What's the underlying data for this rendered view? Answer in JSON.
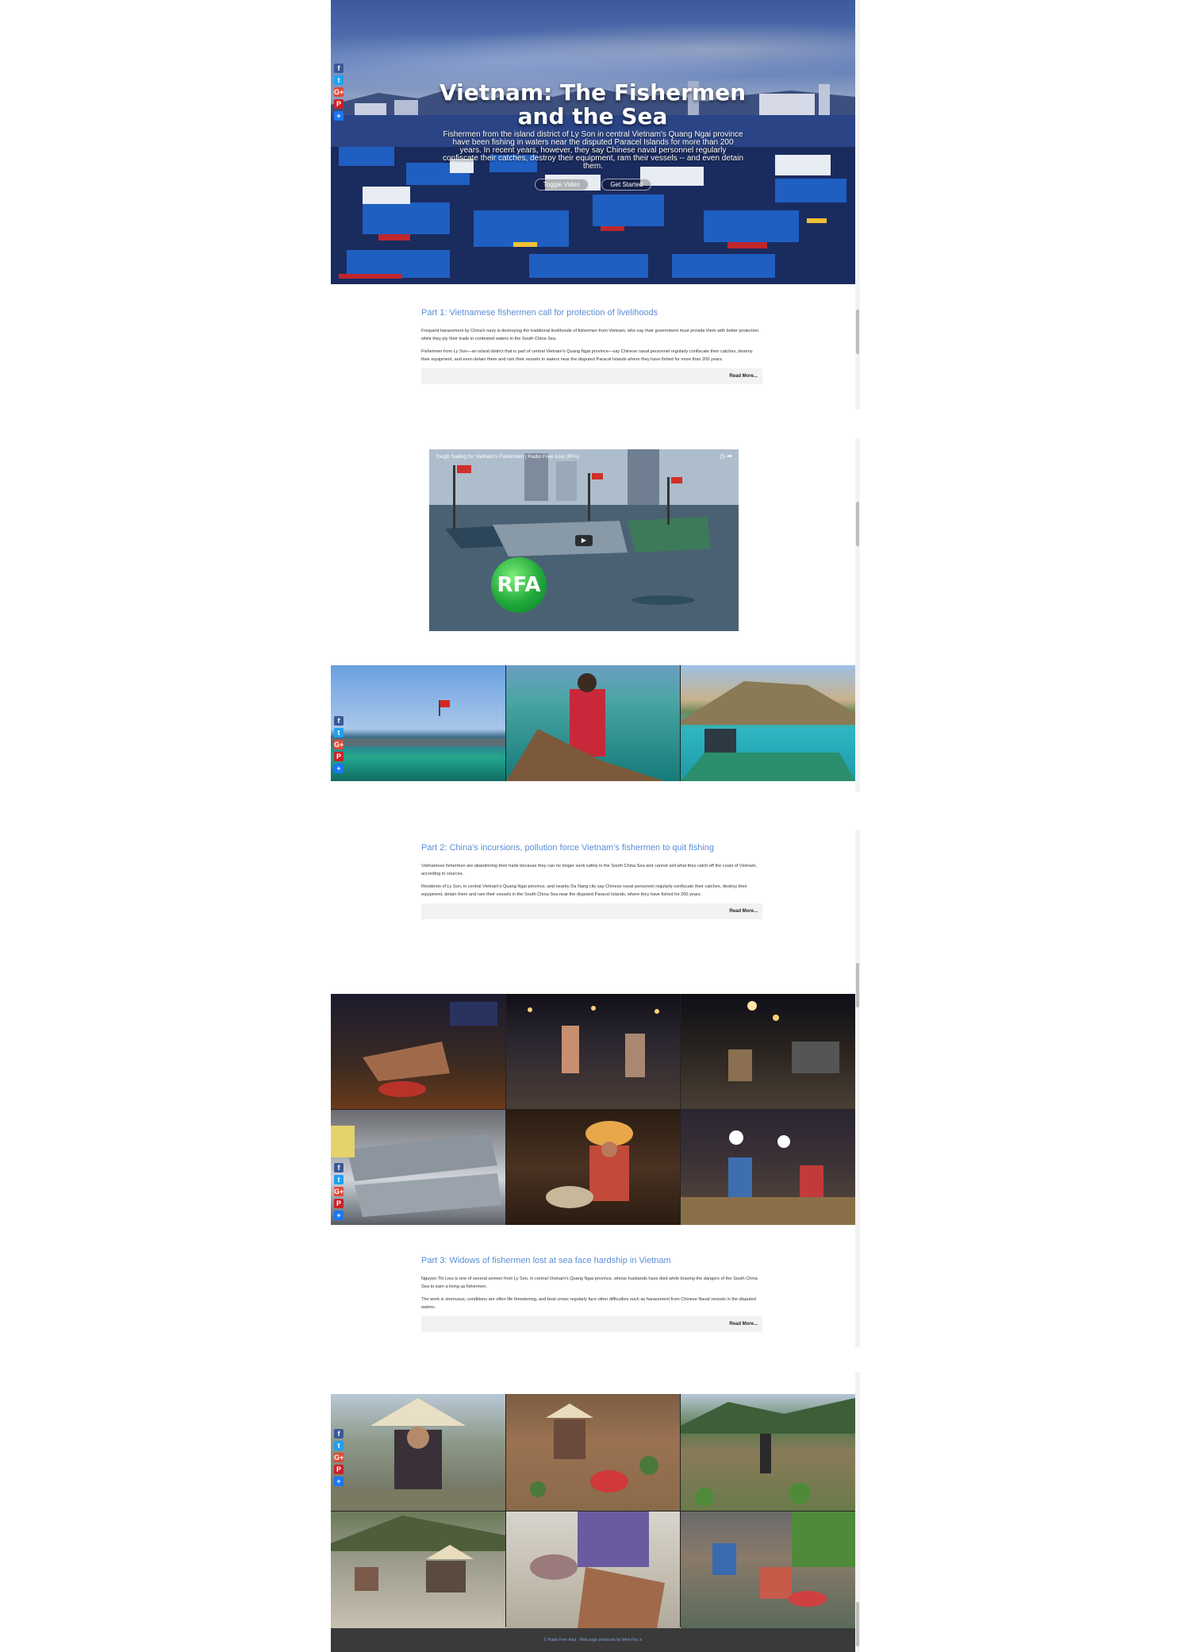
{
  "hero": {
    "title": "Vietnam: The Fishermen and the Sea",
    "subtitle": "Fishermen from the island district of Ly Son in central Vietnam's Quang Ngai province have been fishing in waters near the disputed Paracel Islands for more than 200 years. In recent years, however, they say Chinese naval personnel regularly confiscate their catches, destroy their equipment, ram their vessels -- and even detain them.",
    "buttons": [
      "Toggle Video",
      "Get Started"
    ]
  },
  "share": [
    "f",
    "t",
    "G+",
    "P",
    "+"
  ],
  "articles": [
    {
      "title": "Part 1: Vietnamese fishermen call for protection of livelihoods",
      "paragraphs": [
        "Frequent harassment by China's navy is destroying the traditional livelihoods of fishermen from Vietnam, who say their government must provide them with better protection while they ply their trade in contested waters in the South China Sea.",
        "Fishermen from Ly Son—an island district that is part of central Vietnam's Quang Ngai province—say Chinese naval personnel regularly confiscate their catches, destroy their equipment, and even detain them and ram their vessels in waters near the disputed Paracel Islands where they have fished for more than 200 years."
      ],
      "read_more": "Read More..."
    },
    {
      "title": "Part 2: China's incursions, pollution force Vietnam's fishermen to quit fishing",
      "paragraphs": [
        "Vietnamese fishermen are abandoning their trade because they can no longer work safely in the South China Sea and cannot sell what they catch off the coast of Vietnam, according to sources.",
        "Residents of Ly Son, in central Vietnam's Quang Ngai province, and nearby Da Nang city say Chinese naval personnel regularly confiscate their catches, destroy their equipment, detain them and ram their vessels in the South China Sea near the disputed Paracel Islands, where they have fished for 200 years."
      ],
      "read_more": "Read More..."
    },
    {
      "title": "Part 3: Widows of fishermen lost at sea face hardship in Vietnam",
      "paragraphs": [
        "Nguyen Thi Lieu is one of several women from Ly Son, in central Vietnam's Quang Ngai province, whose husbands have died while braving the dangers of the South China Sea to earn a living as fishermen.",
        "The work is strenuous, conditions are often life threatening, and boat crews regularly face other difficulties such as harassment from Chinese Naval vessels in the disputed waters."
      ],
      "read_more": "Read More..."
    }
  ],
  "video": {
    "title": "Tough Sailing for Vietnam's Fishermen | Radio Free Asia (RFA)",
    "logo": "RFA",
    "play_icon": "play-icon"
  },
  "footer": {
    "text": "© Radio Free Asia · Web page produced by Minh-Ha Le"
  },
  "colors": {
    "link": "#5b8dd6",
    "footer_bg": "#3a3a3a"
  }
}
